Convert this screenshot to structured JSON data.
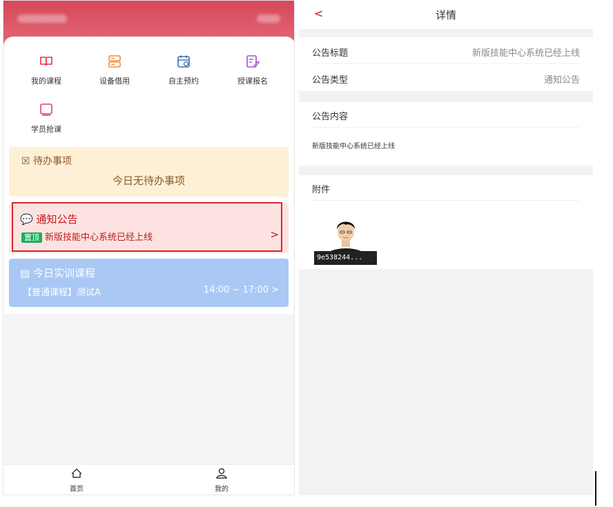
{
  "left": {
    "grid": [
      {
        "label": "我的课程",
        "icon": "book-icon"
      },
      {
        "label": "设备借用",
        "icon": "device-icon"
      },
      {
        "label": "自主预约",
        "icon": "calendar-icon"
      },
      {
        "label": "授课报名",
        "icon": "edit-icon"
      },
      {
        "label": "学员抢课",
        "icon": "tablet-icon"
      }
    ],
    "todo": {
      "title": "待办事项",
      "empty": "今日无待办事项"
    },
    "notice": {
      "title": "通知公告",
      "tag": "置顶",
      "text": "新版技能中心系统已经上线",
      "chevron": ">"
    },
    "course": {
      "title": "今日实训课程",
      "name": "【普通课程】测试A",
      "time": "14:00 ~ 17:00 >"
    },
    "tabs": [
      {
        "label": "首页",
        "icon": "home-icon"
      },
      {
        "label": "我的",
        "icon": "user-icon"
      }
    ]
  },
  "right": {
    "nav": {
      "back": "<",
      "title": "详情"
    },
    "fields": [
      {
        "key": "公告标题",
        "value": "新版技能中心系统已经上线"
      },
      {
        "key": "公告类型",
        "value": "通知公告"
      }
    ],
    "content": {
      "title": "公告内容",
      "body": "新版技能中心系统已经上线"
    },
    "attachment": {
      "title": "附件",
      "filename": "9e538244..."
    }
  },
  "colors": {
    "brand_red": "#d6485a",
    "todo_bg": "#fdf0d6",
    "notice_bg": "#fce3e1",
    "course_bg": "#a9c8f4",
    "tag_green": "#19b15b"
  }
}
